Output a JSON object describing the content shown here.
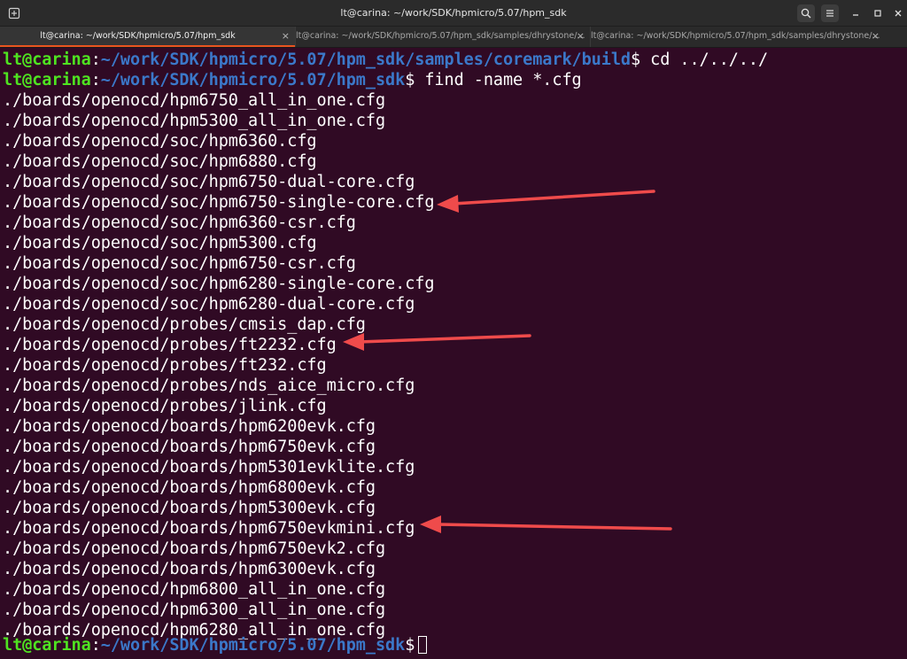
{
  "window": {
    "title": "lt@carina: ~/work/SDK/hpmicro/5.07/hpm_sdk"
  },
  "tabs": [
    {
      "label": "lt@carina: ~/work/SDK/hpmicro/5.07/hpm_sdk",
      "active": true
    },
    {
      "label": "lt@carina: ~/work/SDK/hpmicro/5.07/hpm_sdk/samples/dhrystone/...",
      "active": false
    },
    {
      "label": "lt@carina: ~/work/SDK/hpmicro/5.07/hpm_sdk/samples/dhrystone/...",
      "active": false
    }
  ],
  "icons": {
    "new_tab": "new-tab-icon",
    "search": "search-icon",
    "menu": "hamburger-menu-icon",
    "minimize": "minimize-icon",
    "maximize": "maximize-icon",
    "close": "close-icon"
  },
  "colors": {
    "background": "#300a24",
    "prompt_user": "#4fe321",
    "prompt_path": "#3b78c9",
    "text": "#ffffff",
    "annotation_arrow": "#ef4b4b",
    "tab_accent": "#e95420"
  },
  "terminal": {
    "prompts": [
      {
        "user": "lt@carina",
        "sep": ":",
        "path": "~/work/SDK/hpmicro/5.07/hpm_sdk/samples/coremark/build",
        "symbol": "$",
        "command": " cd ../../../"
      },
      {
        "user": "lt@carina",
        "sep": ":",
        "path": "~/work/SDK/hpmicro/5.07/hpm_sdk",
        "symbol": "$",
        "command": " find -name *.cfg"
      }
    ],
    "output": [
      "./boards/openocd/hpm6750_all_in_one.cfg",
      "./boards/openocd/hpm5300_all_in_one.cfg",
      "./boards/openocd/soc/hpm6360.cfg",
      "./boards/openocd/soc/hpm6880.cfg",
      "./boards/openocd/soc/hpm6750-dual-core.cfg",
      "./boards/openocd/soc/hpm6750-single-core.cfg",
      "./boards/openocd/soc/hpm6360-csr.cfg",
      "./boards/openocd/soc/hpm5300.cfg",
      "./boards/openocd/soc/hpm6750-csr.cfg",
      "./boards/openocd/soc/hpm6280-single-core.cfg",
      "./boards/openocd/soc/hpm6280-dual-core.cfg",
      "./boards/openocd/probes/cmsis_dap.cfg",
      "./boards/openocd/probes/ft2232.cfg",
      "./boards/openocd/probes/ft232.cfg",
      "./boards/openocd/probes/nds_aice_micro.cfg",
      "./boards/openocd/probes/jlink.cfg",
      "./boards/openocd/boards/hpm6200evk.cfg",
      "./boards/openocd/boards/hpm6750evk.cfg",
      "./boards/openocd/boards/hpm5301evklite.cfg",
      "./boards/openocd/boards/hpm6800evk.cfg",
      "./boards/openocd/boards/hpm5300evk.cfg",
      "./boards/openocd/boards/hpm6750evkmini.cfg",
      "./boards/openocd/boards/hpm6750evk2.cfg",
      "./boards/openocd/boards/hpm6300evk.cfg",
      "./boards/openocd/hpm6800_all_in_one.cfg",
      "./boards/openocd/hpm6300_all_in_one.cfg",
      "./boards/openocd/hpm6280_all_in_one.cfg"
    ],
    "final_prompt": {
      "user": "lt@carina",
      "sep": ":",
      "path": "~/work/SDK/hpmicro/5.07/hpm_sdk",
      "symbol": "$"
    },
    "highlighted_lines": [
      "./boards/openocd/soc/hpm6750-single-core.cfg",
      "./boards/openocd/probes/ft2232.cfg",
      "./boards/openocd/boards/hpm6750evkmini.cfg"
    ]
  }
}
